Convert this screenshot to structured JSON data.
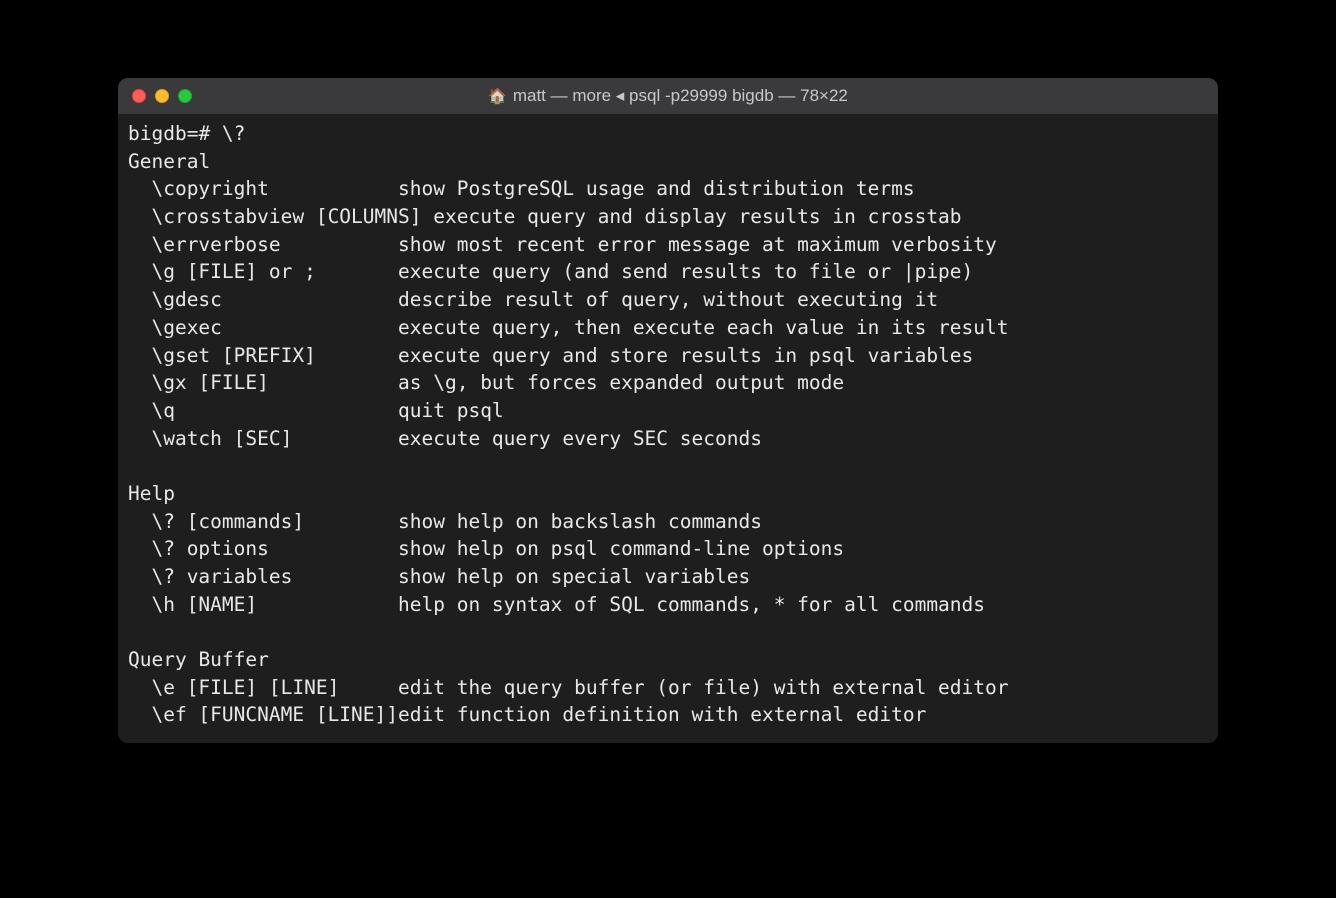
{
  "window": {
    "title": "matt — more ◂ psql -p29999 bigdb — 78×22",
    "home_icon": "🏠"
  },
  "terminal": {
    "prompt": "bigdb=# ",
    "command": "\\?",
    "sections": [
      {
        "header": "General",
        "items": [
          {
            "cmd": "\\copyright",
            "desc": "show PostgreSQL usage and distribution terms"
          },
          {
            "cmd": "\\crosstabview [COLUMNS]",
            "desc": "execute query and display results in crosstab"
          },
          {
            "cmd": "\\errverbose",
            "desc": "show most recent error message at maximum verbosity"
          },
          {
            "cmd": "\\g [FILE] or ;",
            "desc": "execute query (and send results to file or |pipe)"
          },
          {
            "cmd": "\\gdesc",
            "desc": "describe result of query, without executing it"
          },
          {
            "cmd": "\\gexec",
            "desc": "execute query, then execute each value in its result"
          },
          {
            "cmd": "\\gset [PREFIX]",
            "desc": "execute query and store results in psql variables"
          },
          {
            "cmd": "\\gx [FILE]",
            "desc": "as \\g, but forces expanded output mode"
          },
          {
            "cmd": "\\q",
            "desc": "quit psql"
          },
          {
            "cmd": "\\watch [SEC]",
            "desc": "execute query every SEC seconds"
          }
        ]
      },
      {
        "header": "Help",
        "items": [
          {
            "cmd": "\\? [commands]",
            "desc": "show help on backslash commands"
          },
          {
            "cmd": "\\? options",
            "desc": "show help on psql command-line options"
          },
          {
            "cmd": "\\? variables",
            "desc": "show help on special variables"
          },
          {
            "cmd": "\\h [NAME]",
            "desc": "help on syntax of SQL commands, * for all commands"
          }
        ]
      },
      {
        "header": "Query Buffer",
        "items": [
          {
            "cmd": "\\e [FILE] [LINE]",
            "desc": "edit the query buffer (or file) with external editor"
          },
          {
            "cmd": "\\ef [FUNCNAME [LINE]]",
            "desc": "edit function definition with external editor"
          }
        ]
      }
    ]
  }
}
